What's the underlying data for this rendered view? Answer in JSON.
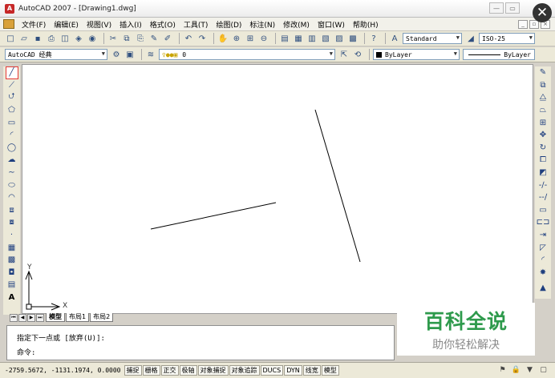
{
  "window": {
    "title": "AutoCAD 2007 - [Drawing1.dwg]",
    "app_badge": "A"
  },
  "menu": {
    "items": [
      "文件(F)",
      "编辑(E)",
      "视图(V)",
      "插入(I)",
      "格式(O)",
      "工具(T)",
      "绘图(D)",
      "标注(N)",
      "修改(M)",
      "窗口(W)",
      "帮助(H)"
    ]
  },
  "toolbar": {
    "text_style": "Standard",
    "dim_style": "ISO-25",
    "workspace": "AutoCAD 经典",
    "layer": "0",
    "color": "ByLayer",
    "linetype": "ByLayer"
  },
  "canvas": {
    "axis_y_label": "Y",
    "axis_x_label": "X"
  },
  "layout_tabs": [
    "模型",
    "布局1",
    "布局2"
  ],
  "command": {
    "line1": "指定下一点或 [放弃(U)]:",
    "line2": "命令:"
  },
  "watermark": {
    "main": "百科全说",
    "sub": "助你轻松解决"
  },
  "status": {
    "coords": "-2759.5672, -1131.1974, 0.0000",
    "buttons": [
      "捕捉",
      "栅格",
      "正交",
      "极轴",
      "对象捕捉",
      "对象追踪",
      "DUCS",
      "DYN",
      "线宽",
      "模型"
    ]
  },
  "colors": {
    "watermark_green": "#2e9a4c",
    "active_tool_border": "#e53935"
  },
  "icons": {
    "left_tools": [
      "line-icon",
      "construction-line-icon",
      "polyline-icon",
      "polygon-icon",
      "rectangle-icon",
      "arc-icon",
      "circle-icon",
      "revision-cloud-icon",
      "spline-icon",
      "ellipse-icon",
      "ellipse-arc-icon",
      "insert-block-icon",
      "make-block-icon",
      "point-icon",
      "hatch-icon",
      "gradient-icon",
      "region-icon",
      "table-icon",
      "multiline-text-icon"
    ],
    "right_tools": [
      "erase-icon",
      "copy-icon",
      "mirror-icon",
      "offset-icon",
      "array-icon",
      "move-icon",
      "rotate-icon",
      "scale-icon",
      "stretch-icon",
      "trim-icon",
      "extend-icon",
      "break-point-icon",
      "break-icon",
      "join-icon",
      "chamfer-icon",
      "fillet-icon",
      "explode-icon"
    ]
  }
}
